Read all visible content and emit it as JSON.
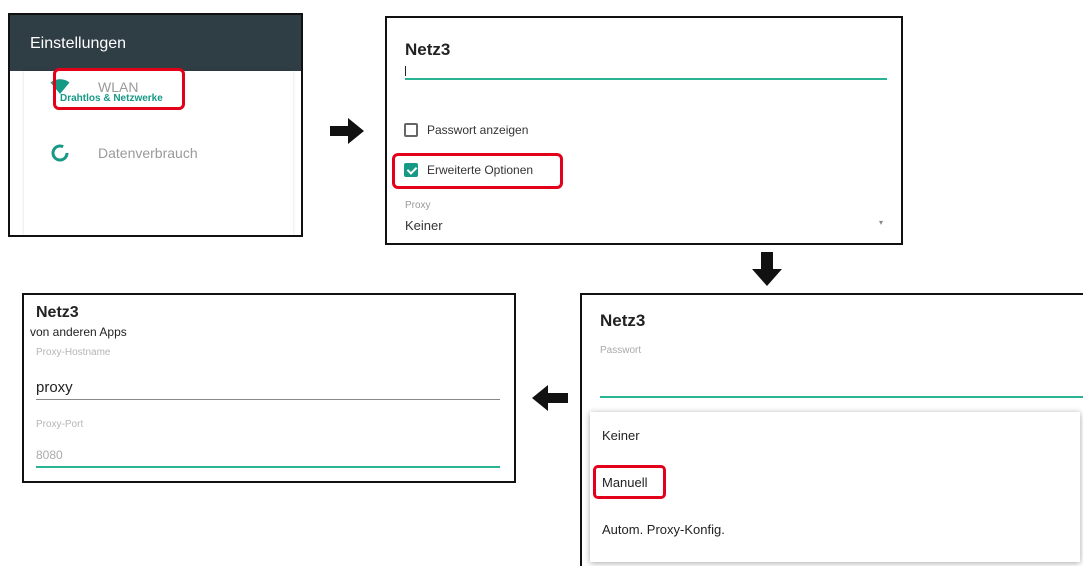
{
  "panel1": {
    "title": "Einstellungen",
    "section": "Drahtlos & Netzwerke",
    "items": [
      {
        "label": "WLAN",
        "icon": "wifi-icon"
      },
      {
        "label": "Datenverbrauch",
        "icon": "data-usage-icon"
      }
    ]
  },
  "panel2": {
    "title": "Netz3",
    "checkboxes": [
      {
        "label": "Passwort anzeigen",
        "checked": false
      },
      {
        "label": "Erweiterte Optionen",
        "checked": true
      }
    ],
    "proxy_label": "Proxy",
    "proxy_value": "Keiner"
  },
  "panel3": {
    "title": "Netz3",
    "subtitle": "von anderen Apps",
    "field1_label": "Proxy-Hostname",
    "field1_value": "proxy",
    "field2_label": "Proxy-Port",
    "field2_value": "8080"
  },
  "panel4": {
    "title": "Netz3",
    "password_label": "Passwort",
    "menu": [
      "Keiner",
      "Manuell",
      "Autom. Proxy-Konfig."
    ]
  },
  "colors": {
    "accent": "#169a86",
    "highlight": "#e3001b",
    "appbar": "#2f3d44"
  }
}
